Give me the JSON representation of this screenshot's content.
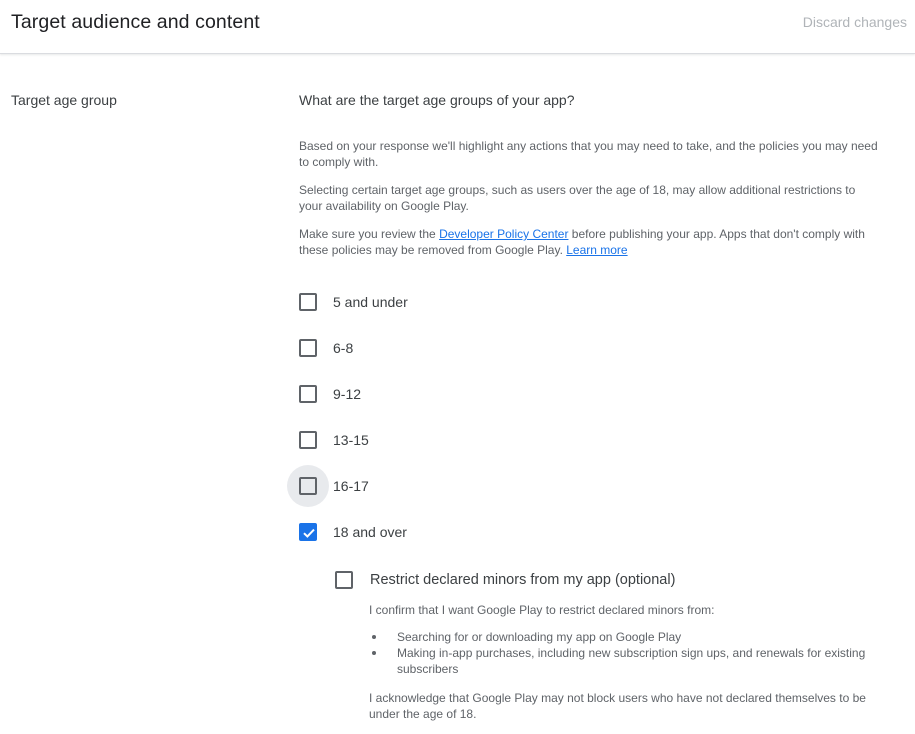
{
  "header": {
    "title": "Target audience and content",
    "discard_label": "Discard changes"
  },
  "section": {
    "label": "Target age group",
    "question": "What are the target age groups of your app?",
    "para1": "Based on your response we'll highlight any actions that you may need to take, and the policies you may need to comply with.",
    "para2": "Selecting certain target age groups, such as users over the age of 18, may allow additional restrictions to your availability on Google Play.",
    "para3_before": "Make sure you review the ",
    "para3_link": "Developer Policy Center",
    "para3_middle": " before publishing your app. Apps that don't comply with these policies may be removed from Google Play. ",
    "para3_learn_more": "Learn more"
  },
  "age_options": [
    {
      "label": "5 and under",
      "checked": false
    },
    {
      "label": "6-8",
      "checked": false
    },
    {
      "label": "9-12",
      "checked": false
    },
    {
      "label": "13-15",
      "checked": false
    },
    {
      "label": "16-17",
      "checked": false,
      "hovered": true
    },
    {
      "label": "18 and over",
      "checked": true
    }
  ],
  "restrict": {
    "label": "Restrict declared minors from my app (optional)",
    "checked": false,
    "confirm": "I confirm that I want Google Play to restrict declared minors from:",
    "bullets": [
      "Searching for or downloading my app on Google Play",
      "Making in-app purchases, including new subscription sign ups, and renewals for existing subscribers"
    ],
    "acknowledge": "I acknowledge that Google Play may not block users who have not declared themselves to be under the age of 18."
  },
  "colors": {
    "accent": "#1a73e8",
    "checkbox_border": "#5f6368",
    "muted_text": "#5f6368"
  }
}
